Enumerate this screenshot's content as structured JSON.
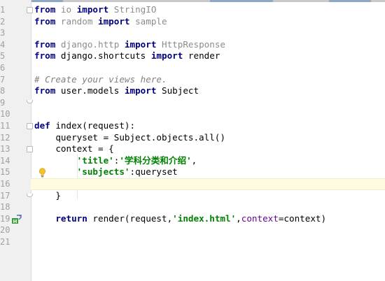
{
  "line_numbers": [
    "1",
    "2",
    "3",
    "4",
    "5",
    "6",
    "7",
    "8",
    "9",
    "10",
    "11",
    "12",
    "13",
    "14",
    "15",
    "16",
    "17",
    "18",
    "19",
    "20",
    "21"
  ],
  "code": {
    "l1": {
      "kw1": "from",
      "mod": " io ",
      "kw2": "import",
      "name": " StringIO"
    },
    "l2": {
      "kw1": "from",
      "mod": " random ",
      "kw2": "import",
      "name": " sample"
    },
    "l4": {
      "kw1": "from",
      "mod": " django.http ",
      "kw2": "import",
      "name": " HttpResponse"
    },
    "l5": {
      "kw1": "from",
      "mod": " django.shortcuts ",
      "kw2": "import",
      "name": " render"
    },
    "l7": {
      "comment": "# Create your views here."
    },
    "l8": {
      "kw1": "from",
      "mod": " user.models ",
      "kw2": "import",
      "name": " Subject"
    },
    "l11": {
      "kw": "def",
      "rest": " index(request):"
    },
    "l12": {
      "text": "    queryset = Subject.objects.all()"
    },
    "l13": {
      "text": "    context = {"
    },
    "l14": {
      "indent": "        ",
      "key": "'title'",
      "colon": ":",
      "value": "'学科分类和介绍'",
      "comma": ","
    },
    "l15": {
      "indent": "        ",
      "key": "'subjects'",
      "rest": ":queryset"
    },
    "l17": {
      "text": "    }"
    },
    "l19": {
      "indent": "    ",
      "kw": "return",
      "pre": " render(request,",
      "template": "'index.html'",
      "comma": ",",
      "param": "context",
      "post": "=context)"
    }
  },
  "colors": {
    "keyword": "#000080",
    "string": "#008000",
    "comment": "#808080",
    "param": "#660099",
    "gutter": "#f0f0f0",
    "current_line": "#fffbe0"
  },
  "icons": {
    "fold_markers": "fold-marker-icon",
    "intention_bulb": "lightbulb-icon",
    "override": "override-marker-icon"
  }
}
